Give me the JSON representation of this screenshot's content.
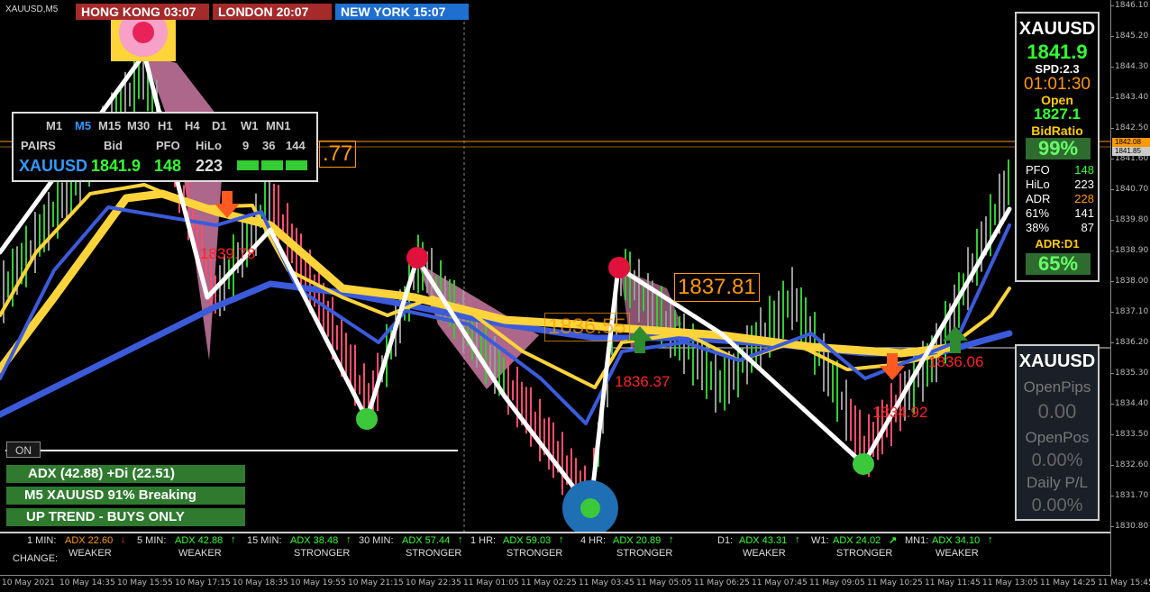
{
  "symbol_label": "XAUUSD,M5",
  "sessions": [
    {
      "name": "HONG KONG",
      "time": "03:07",
      "color": "#a52a2a"
    },
    {
      "name": "LONDON",
      "time": "20:07",
      "color": "#a52a2a"
    },
    {
      "name": "NEW YORK",
      "time": "15:07",
      "color": "#1e6fd0"
    }
  ],
  "tf_panel": {
    "timeframes": [
      "M1",
      "M5",
      "M15",
      "M30",
      "H1",
      "H4",
      "D1",
      "W1",
      "MN1"
    ],
    "active_tf": "M5",
    "headers": [
      "PAIRS",
      "Bid",
      "PFO",
      "HiLo",
      "9",
      "36",
      "144"
    ],
    "pair": "XAUUSD",
    "bid": "1841.9",
    "pfo": "148",
    "hilo": "223"
  },
  "info_panel": {
    "symbol": "XAUUSD",
    "price": "1841.9",
    "spread": "SPD:2.3",
    "countdown": "01:01:30",
    "open_label": "Open",
    "open_value": "1827.1",
    "bid_ratio_label": "BidRatio",
    "bid_ratio_value": "99%",
    "rows": [
      {
        "k": "PFO",
        "v": "148",
        "color": "#33ff33"
      },
      {
        "k": "HiLo",
        "v": "223",
        "color": "#ffffff"
      },
      {
        "k": "ADR",
        "v": "228",
        "color": "#ff9900"
      },
      {
        "k": "61%",
        "v": "141",
        "color": "#ffffff"
      },
      {
        "k": "38%",
        "v": "87",
        "color": "#ffffff"
      }
    ],
    "adr_label": "ADR:D1",
    "adr_value": "65%"
  },
  "acct_panel": {
    "symbol": "XAUUSD",
    "open_pips_label": "OpenPips",
    "open_pips_value": "0.00",
    "open_pos_label": "OpenPos",
    "open_pos_value": "0.00%",
    "daily_pl_label": "Daily P/L",
    "daily_pl_value": "0.00%"
  },
  "on_button": "ON",
  "status_bars": [
    "ADX (42.88)   +Di (22.51)",
    "M5 XAUUSD 91% Breaking",
    "UP TREND - BUYS ONLY"
  ],
  "chart_labels": {
    "l1": "1839.78",
    "l2": "1836.37",
    "l3": "1834.92",
    "l4": "1836.06",
    "box1": "1837.81",
    "box2": "1836.55",
    "box3": ".77"
  },
  "adx_strip": {
    "change_label": "CHANGE:",
    "items": [
      {
        "tf": "1 MIN:",
        "adx": "ADX 22.60",
        "adx_color": "#ff9900",
        "arrow": "↓",
        "arrow_color": "#ff3333",
        "state": "WEAKER"
      },
      {
        "tf": "5 MIN:",
        "adx": "ADX 42.88",
        "adx_color": "#33ff33",
        "arrow": "↑",
        "arrow_color": "#33ff33",
        "state": "WEAKER"
      },
      {
        "tf": "15 MIN:",
        "adx": "ADX 38.48",
        "adx_color": "#33ff33",
        "arrow": "↑",
        "arrow_color": "#33ff33",
        "state": "STRONGER"
      },
      {
        "tf": "30 MIN:",
        "adx": "ADX 57.44",
        "adx_color": "#33ff33",
        "arrow": "↑",
        "arrow_color": "#33ff33",
        "state": "STRONGER"
      },
      {
        "tf": "1 HR:",
        "adx": "ADX 59.03",
        "adx_color": "#33ff33",
        "arrow": "↑",
        "arrow_color": "#33ff33",
        "state": "STRONGER"
      },
      {
        "tf": "4 HR:",
        "adx": "ADX 20.89",
        "adx_color": "#33ff33",
        "arrow": "↑",
        "arrow_color": "#33ff33",
        "state": "STRONGER"
      },
      {
        "tf": "D1:",
        "adx": "ADX 43.31",
        "adx_color": "#33ff33",
        "arrow": "↑",
        "arrow_color": "#33ff33",
        "state": "WEAKER"
      },
      {
        "tf": "W1:",
        "adx": "ADX 24.02",
        "adx_color": "#33ff33",
        "arrow": "↗",
        "arrow_color": "#33ff33",
        "state": "STRONGER"
      },
      {
        "tf": "MN1:",
        "adx": "ADX 34.10",
        "adx_color": "#33ff33",
        "arrow": "↑",
        "arrow_color": "#33ff33",
        "state": "WEAKER"
      }
    ]
  },
  "price_axis": [
    "1846.10",
    "1845.20",
    "1844.30",
    "1843.40",
    "1842.50",
    "1841.60",
    "1840.70",
    "1839.80",
    "1838.90",
    "1838.00",
    "1837.10",
    "1836.20",
    "1835.30",
    "1834.40",
    "1833.50",
    "1832.60",
    "1831.70",
    "1830.80"
  ],
  "price_badges": [
    {
      "text": "1842.08",
      "color": "#ff9900"
    },
    {
      "text": "1841.85",
      "color": "#cccccc"
    }
  ],
  "time_axis": [
    "10 May 2021",
    "10 May 14:35",
    "10 May 15:55",
    "10 May 17:15",
    "10 May 18:35",
    "10 May 19:55",
    "10 May 21:15",
    "10 May 22:35",
    "11 May 01:05",
    "11 May 02:25",
    "11 May 03:45",
    "11 May 05:05",
    "11 May 06:25",
    "11 May 07:45",
    "11 May 09:05",
    "11 May 10:25",
    "11 May 11:45",
    "11 May 13:05",
    "11 May 14:25",
    "11 May 15:45"
  ]
}
